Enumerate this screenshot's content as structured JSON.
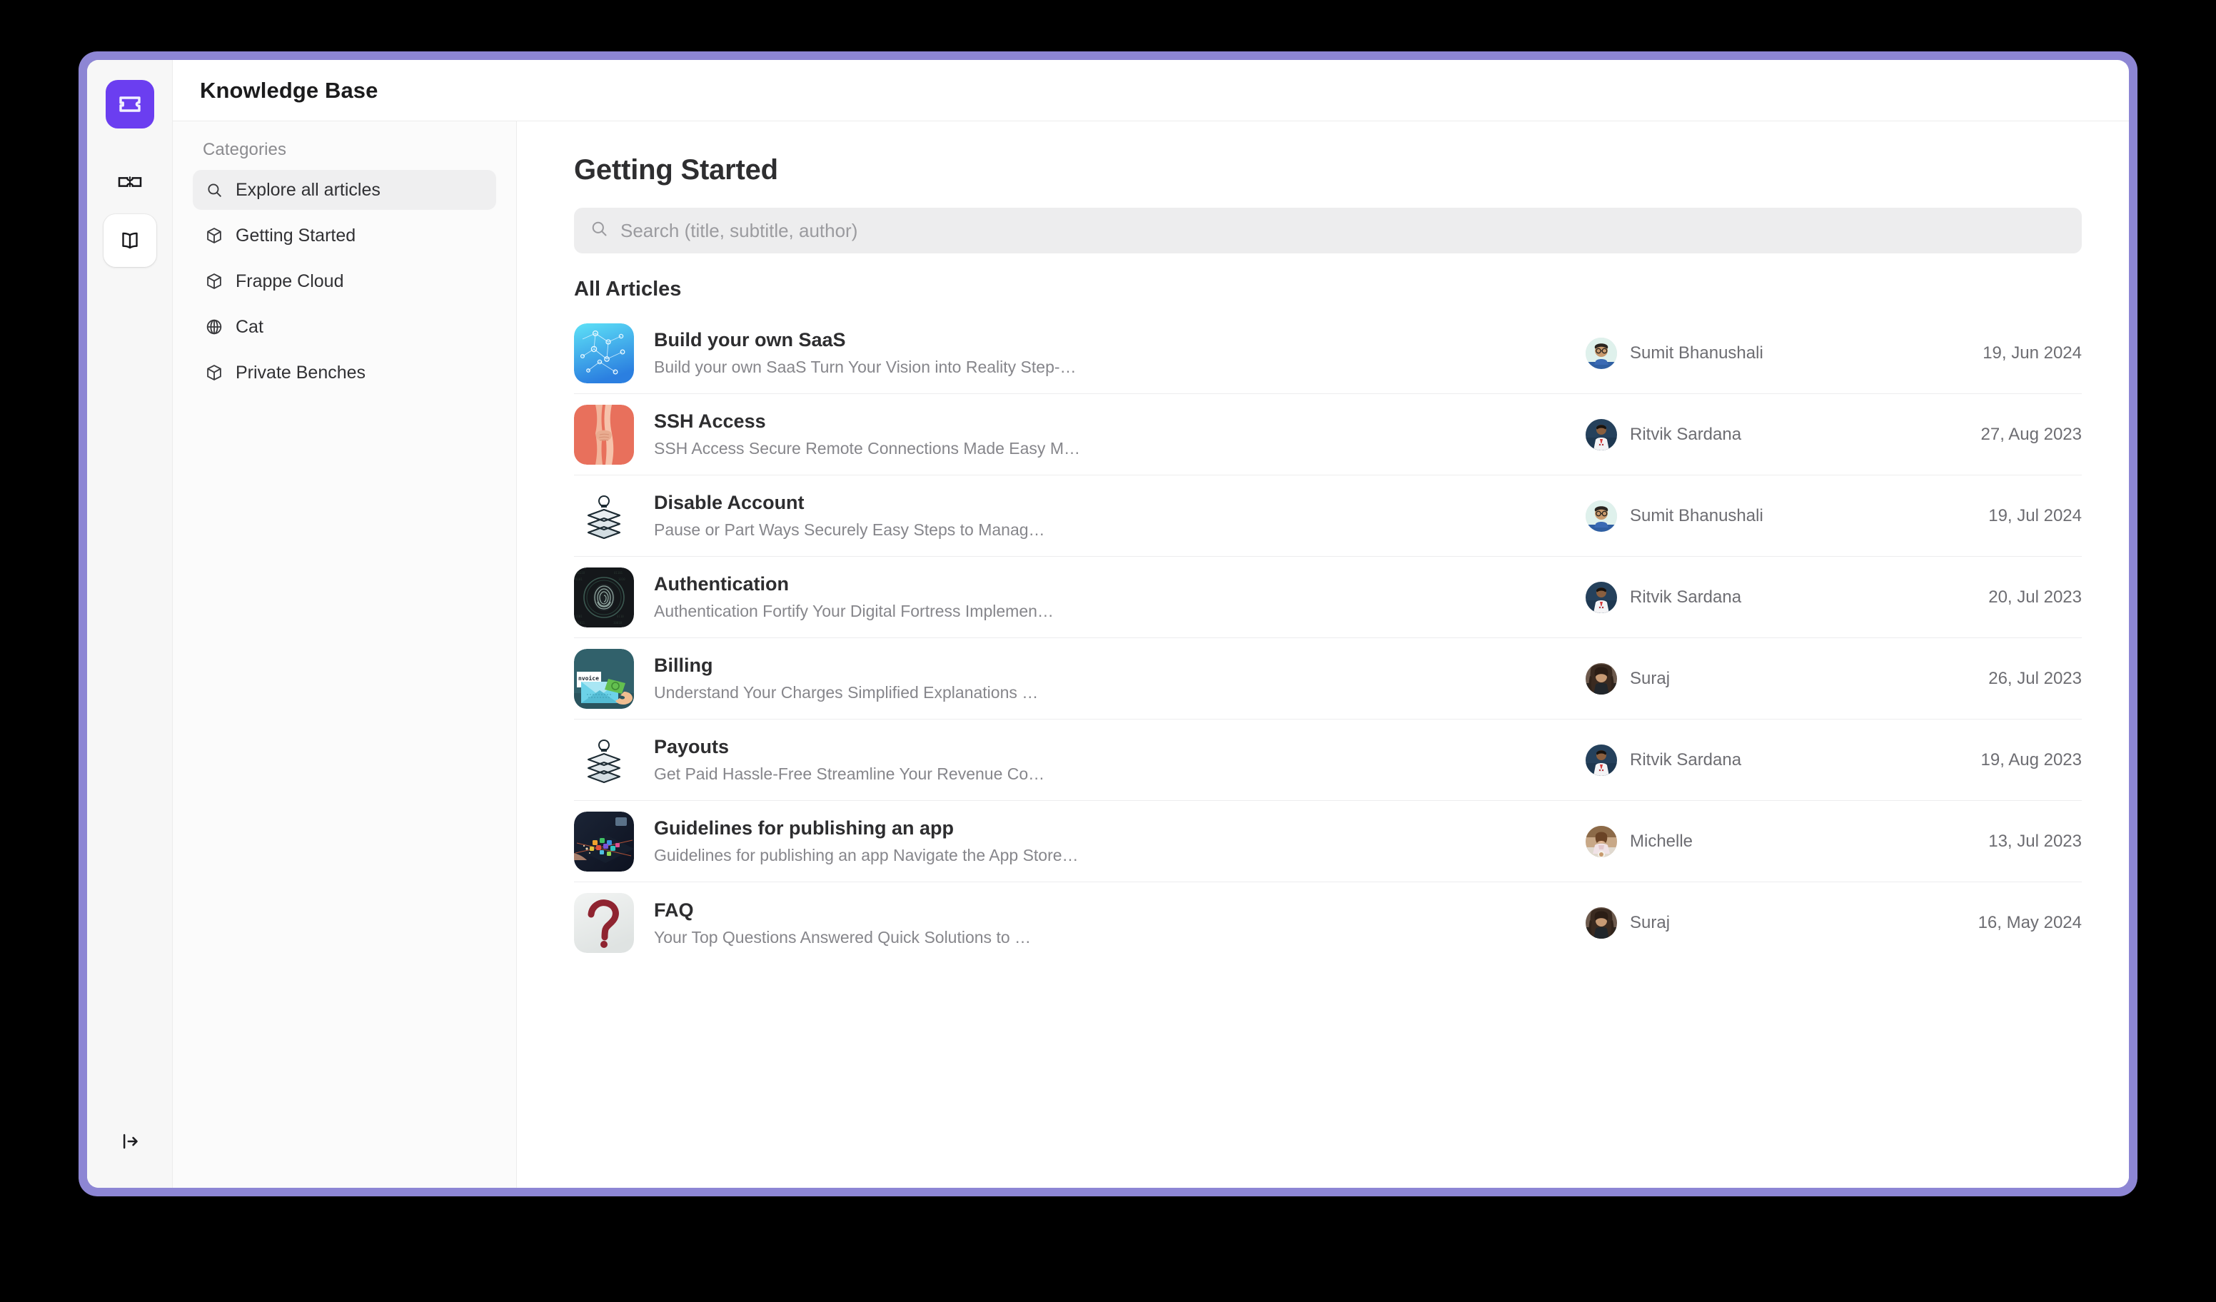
{
  "window": {
    "frame_color": "#8d86d4",
    "app_title": "Knowledge Base"
  },
  "rail": {
    "logo_name": "frappe-helpdesk-logo",
    "items": [
      {
        "name": "tickets-icon",
        "label": "Tickets",
        "active": false
      },
      {
        "name": "knowledge-base-icon",
        "label": "Knowledge Base",
        "active": true
      }
    ],
    "bottom": {
      "name": "logout-icon",
      "label": "Log out"
    }
  },
  "sidebar": {
    "heading": "Categories",
    "items": [
      {
        "label": "Explore all articles",
        "icon": "search-icon",
        "selected": true
      },
      {
        "label": "Getting Started",
        "icon": "cube-icon",
        "selected": false
      },
      {
        "label": "Frappe Cloud",
        "icon": "cube-icon",
        "selected": false
      },
      {
        "label": "Cat",
        "icon": "globe-icon",
        "selected": false
      },
      {
        "label": "Private Benches",
        "icon": "cube-icon",
        "selected": false
      }
    ]
  },
  "content": {
    "page_title": "Getting Started",
    "search": {
      "placeholder": "Search (title, subtitle, author)",
      "value": "",
      "icon": "search-icon"
    },
    "section_heading": "All Articles",
    "articles": [
      {
        "title": "Build your own SaaS",
        "subtitle": "Build your own SaaS Turn Your Vision into Reality Step-…",
        "author": "Sumit Bhanushali",
        "date": "19, Jun 2024",
        "thumb": "saas-network-blue"
      },
      {
        "title": "SSH Access",
        "subtitle": "SSH Access Secure Remote Connections Made Easy M…",
        "author": "Ritvik Sardana",
        "date": "27, Aug 2023",
        "thumb": "handshake-red"
      },
      {
        "title": "Disable Account",
        "subtitle": "Pause or Part Ways Securely Easy Steps to Manag…",
        "author": "Sumit Bhanushali",
        "date": "19, Jul 2024",
        "thumb": "books-lightbulb-white"
      },
      {
        "title": "Authentication",
        "subtitle": "Authentication Fortify Your Digital Fortress Implemen…",
        "author": "Ritvik Sardana",
        "date": "20, Jul 2023",
        "thumb": "fingerprint-dark"
      },
      {
        "title": "Billing",
        "subtitle": "Understand Your Charges Simplified Explanations …",
        "author": "Suraj",
        "date": "26, Jul 2023",
        "thumb": "invoice-envelope-teal"
      },
      {
        "title": "Payouts",
        "subtitle": "Get Paid Hassle-Free Streamline Your Revenue Co…",
        "author": "Ritvik Sardana",
        "date": "19, Aug 2023",
        "thumb": "books-lightbulb-white"
      },
      {
        "title": "Guidelines for publishing an app",
        "subtitle": "Guidelines for publishing an app Navigate the App Store…",
        "author": "Michelle",
        "date": "13, Jul 2023",
        "thumb": "app-icons-dark"
      },
      {
        "title": "FAQ",
        "subtitle": "Your Top Questions Answered Quick Solutions to …",
        "author": "Suraj",
        "date": "16, May 2024",
        "thumb": "question-mark-red"
      }
    ]
  }
}
